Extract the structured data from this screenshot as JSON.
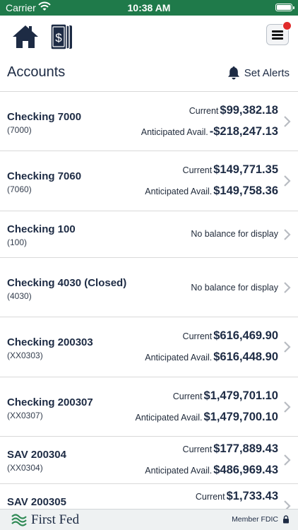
{
  "status_bar": {
    "carrier": "Carrier",
    "time": "10:38 AM"
  },
  "header": {
    "title": "Accounts",
    "alerts_label": "Set Alerts"
  },
  "accounts": [
    {
      "name": "Checking 7000",
      "number": "(7000)",
      "current_label": "Current",
      "current": "$99,382.18",
      "anticipated_label": "Anticipated Avail.",
      "anticipated": "-$218,247.13"
    },
    {
      "name": "Checking 7060",
      "number": "(7060)",
      "current_label": "Current",
      "current": "$149,771.35",
      "anticipated_label": "Anticipated Avail.",
      "anticipated": "$149,758.36"
    },
    {
      "name": "Checking 100",
      "number": "(100)",
      "no_balance": "No balance for display"
    },
    {
      "name": "Checking 4030 (Closed)",
      "number": "(4030)",
      "no_balance": "No balance for display"
    },
    {
      "name": "Checking 200303",
      "number": "(XX0303)",
      "current_label": "Current",
      "current": "$616,469.90",
      "anticipated_label": "Anticipated Avail.",
      "anticipated": "$616,448.90"
    },
    {
      "name": "Checking 200307",
      "number": "(XX0307)",
      "current_label": "Current",
      "current": "$1,479,701.10",
      "anticipated_label": "Anticipated Avail.",
      "anticipated": "$1,479,700.10"
    },
    {
      "name": "SAV 200304",
      "number": "(XX0304)",
      "current_label": "Current",
      "current": "$177,889.43",
      "anticipated_label": "Anticipated Avail.",
      "anticipated": "$486,969.43"
    },
    {
      "name": "SAV 200305",
      "current_label": "Current",
      "current": "$1,733.43"
    }
  ],
  "footer": {
    "brand": "First Fed",
    "fdic": "Member FDIC"
  },
  "icons": {
    "home": "home-icon",
    "deposit": "mobile-deposit-icon",
    "menu": "hamburger-menu-icon",
    "alerts": "bell-icon",
    "chevron": "chevron-right-icon",
    "lock": "lock-icon"
  },
  "colors": {
    "status_bar": "#1f7a4a",
    "text_primary": "#1d2b44",
    "notification": "#e02b2b"
  }
}
